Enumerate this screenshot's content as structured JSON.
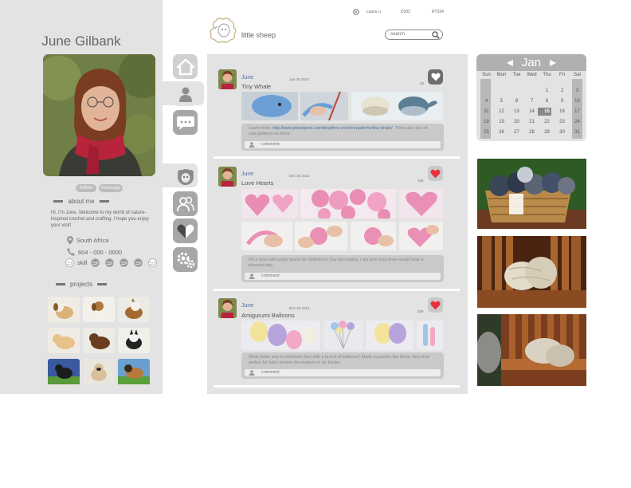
{
  "header": {
    "user_items": [
      "Laura Li",
      "D102",
      "RT334"
    ],
    "logo_text": "little sheep",
    "search_placeholder": "search"
  },
  "profile": {
    "name": "June Gilbank",
    "follow_label": "follow",
    "message_label": "message",
    "about_title": "about me",
    "bio": "Hi, I'm June. Welcome to my world of nature-inspired crochet and crafting. I hope you enjoy your visit!",
    "location": "South Africa",
    "phone": "604 - 000 - 0000",
    "skill_label": "skill",
    "skill_level": 4,
    "skill_max": 5,
    "projects_title": "projects"
  },
  "nav": [
    "home-icon",
    "profile-icon",
    "messages-icon",
    "sheep-icon",
    "friends-icon",
    "favorites-icon",
    "settings-icon"
  ],
  "posts": [
    {
      "author": "June",
      "date": "Jan 08 2013",
      "title": "Tiny Whale",
      "count": "33",
      "liked": false,
      "text_prefix": "Learnt from: ",
      "link": "http://www.planetjune.com/blog/free-crochet-patterns/tiny-whale/",
      "text_suffix": ". There also lots of cute patterns on there.",
      "comment_placeholder": "comment"
    },
    {
      "author": "June",
      "date": "Dec 25 2013",
      "title": "Love Hearts",
      "count": "106",
      "liked": true,
      "text": "Fill a bowl with pretty hearts for Valentine's Day decorating. I am sure your lover would have a pleasant day.",
      "comment_placeholder": "comment"
    },
    {
      "author": "June",
      "date": "Dec 25 2013",
      "title": "Amigurumi Balloons",
      "count": "256",
      "liked": true,
      "text": "What better way to celebrate than with a bunch of balloons? Made in pastels like these, they'd be perfect for baby shower decorations or for Easter.",
      "comment_placeholder": "comment"
    }
  ],
  "calendar": {
    "month": "Jan",
    "weekdays": [
      "Sun",
      "Mon",
      "Tue",
      "Wed",
      "Thu",
      "Fri",
      "Sat"
    ],
    "weeks": [
      [
        "",
        "",
        "",
        "",
        "1",
        "2",
        "3"
      ],
      [
        "4",
        "5",
        "6",
        "7",
        "8",
        "9",
        "10"
      ],
      [
        "11",
        "12",
        "13",
        "14",
        "15",
        "16",
        "17"
      ],
      [
        "18",
        "19",
        "20",
        "21",
        "22",
        "23",
        "24"
      ],
      [
        "25",
        "26",
        "27",
        "28",
        "29",
        "30",
        "31"
      ]
    ],
    "today": "15"
  },
  "colors": {
    "panel": "#e3e3e3",
    "accent_link": "#4a6fa5",
    "like_active": "#e8303a",
    "nav_icon_bg": "#a7a7a7"
  }
}
